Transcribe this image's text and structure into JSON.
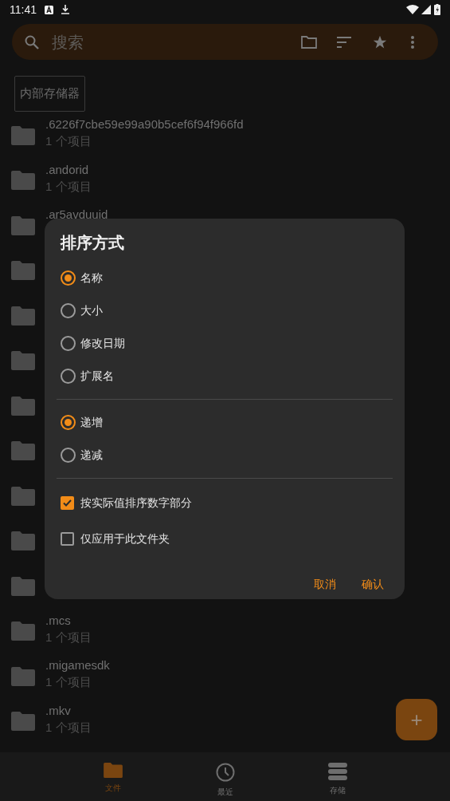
{
  "status_bar": {
    "time": "11:41"
  },
  "search": {
    "placeholder": "搜索"
  },
  "breadcrumb": "内部存储器",
  "files": [
    {
      "kind": "folder",
      "name": ".6226f7cbe59e99a90b5cef6f94f966fd",
      "subtitle": "1 个项目"
    },
    {
      "kind": "folder",
      "name": ".andorid",
      "subtitle": "1 个项目"
    },
    {
      "kind": "folder",
      "name": ".ar5avduuid"
    },
    {
      "kind": "folder"
    },
    {
      "kind": "folder"
    },
    {
      "kind": "folder"
    },
    {
      "kind": "folder"
    },
    {
      "kind": "folder"
    },
    {
      "kind": "folder"
    },
    {
      "kind": "folder"
    },
    {
      "kind": "folder"
    },
    {
      "kind": "folder",
      "name": ".mcs",
      "subtitle": "1 个项目"
    },
    {
      "kind": "folder",
      "name": ".migamesdk",
      "subtitle": "1 个项目"
    },
    {
      "kind": "folder",
      "name": ".mkv",
      "subtitle": "1 个项目"
    }
  ],
  "dialog": {
    "title": "排序方式",
    "sort_by": [
      {
        "label": "名称",
        "selected": true
      },
      {
        "label": "大小",
        "selected": false
      },
      {
        "label": "修改日期",
        "selected": false
      },
      {
        "label": "扩展名",
        "selected": false
      }
    ],
    "order": [
      {
        "label": "递增",
        "selected": true
      },
      {
        "label": "递减",
        "selected": false
      }
    ],
    "options": [
      {
        "label": "按实际值排序数字部分",
        "checked": true
      },
      {
        "label": "仅应用于此文件夹",
        "checked": false
      }
    ],
    "buttons": [
      "取消",
      "确认"
    ]
  },
  "fab": "+",
  "nav": [
    {
      "label": "文件",
      "selected": true,
      "kind": "folder"
    },
    {
      "label": "最近",
      "selected": false,
      "kind": "clock"
    },
    {
      "label": "存储",
      "selected": false,
      "kind": "storage"
    }
  ]
}
